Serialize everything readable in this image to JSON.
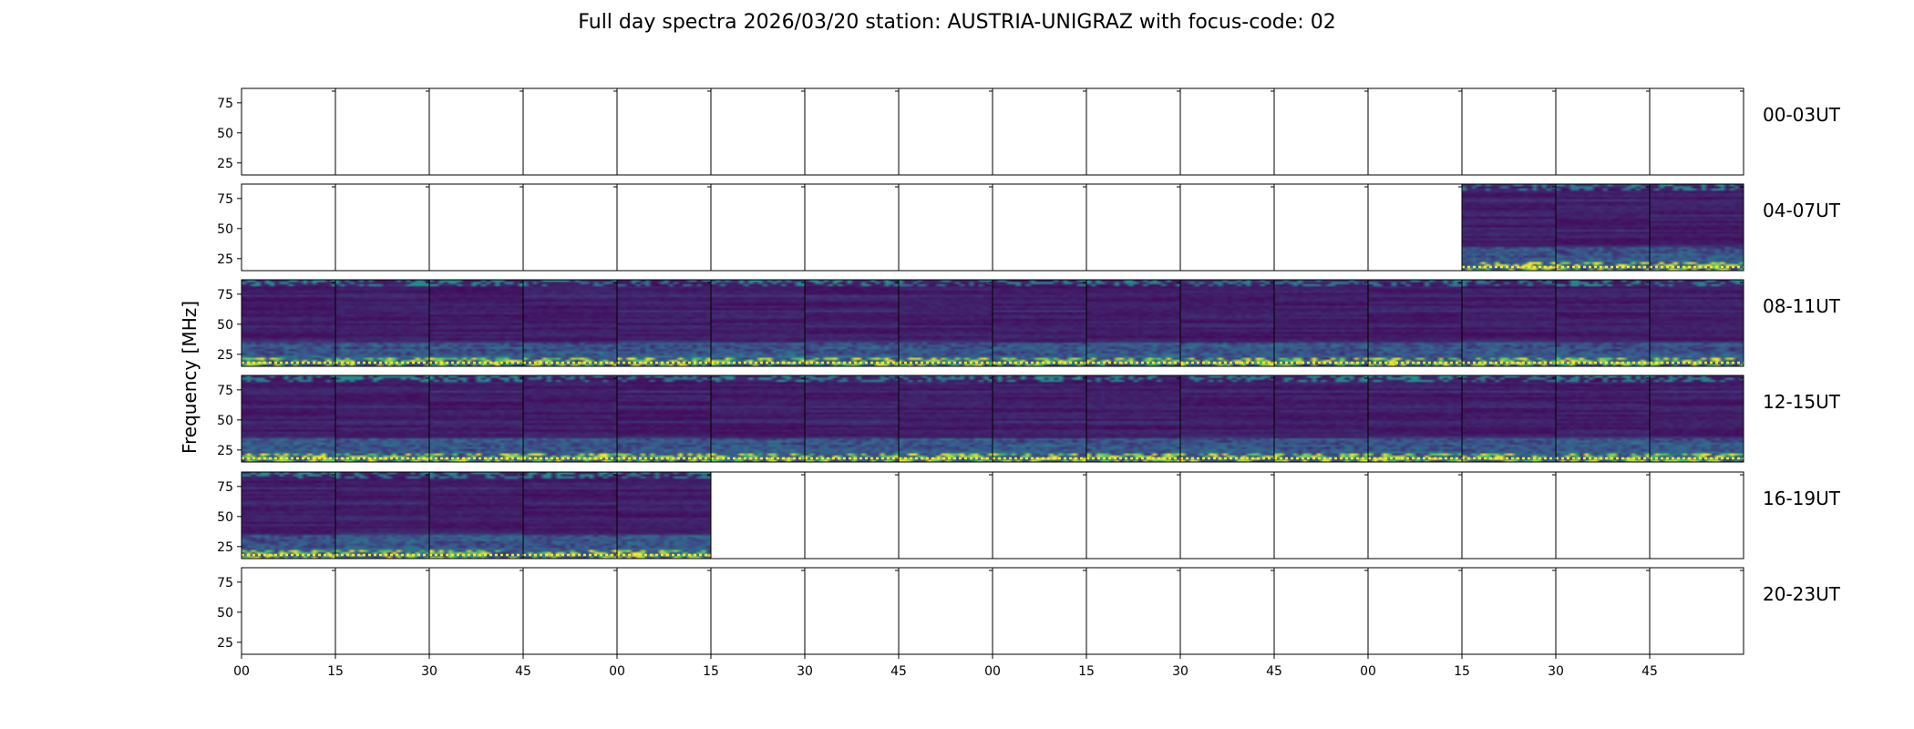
{
  "chart_data": {
    "type": "heatmap",
    "title": "Full day spectra 2026/03/20 station: AUSTRIA-UNIGRAZ with focus-code: 02",
    "xlabel": "",
    "ylabel": "Frequency [MHz]",
    "y_ticks": [
      25,
      50,
      75
    ],
    "ylim": [
      15,
      87
    ],
    "x_tick_labels": [
      "00",
      "15",
      "30",
      "45",
      "00",
      "15",
      "30",
      "45",
      "00",
      "15",
      "30",
      "45",
      "00",
      "15",
      "30",
      "45"
    ],
    "rows": [
      {
        "label": "00-03UT",
        "panels": [
          0,
          0,
          0,
          0,
          0,
          0,
          0,
          0,
          0,
          0,
          0,
          0,
          0,
          0,
          0,
          0
        ]
      },
      {
        "label": "04-07UT",
        "panels": [
          0,
          0,
          0,
          0,
          0,
          0,
          0,
          0,
          0,
          0,
          0,
          0,
          0,
          1,
          1,
          1
        ]
      },
      {
        "label": "08-11UT",
        "panels": [
          1,
          1,
          1,
          1,
          1,
          1,
          1,
          1,
          1,
          1,
          1,
          1,
          1,
          1,
          1,
          1
        ]
      },
      {
        "label": "12-15UT",
        "panels": [
          1,
          1,
          1,
          1,
          1,
          1,
          1,
          1,
          1,
          1,
          1,
          1,
          1,
          1,
          1,
          1
        ]
      },
      {
        "label": "16-19UT",
        "panels": [
          1,
          1,
          1,
          1,
          1,
          0,
          0,
          0,
          0,
          0,
          0,
          0,
          0,
          0,
          0,
          0
        ]
      },
      {
        "label": "20-23UT",
        "panels": [
          0,
          0,
          0,
          0,
          0,
          0,
          0,
          0,
          0,
          0,
          0,
          0,
          0,
          0,
          0,
          0
        ]
      }
    ],
    "colormap": [
      "#440154",
      "#3b528b",
      "#21918c",
      "#5ec962",
      "#fde725"
    ]
  }
}
